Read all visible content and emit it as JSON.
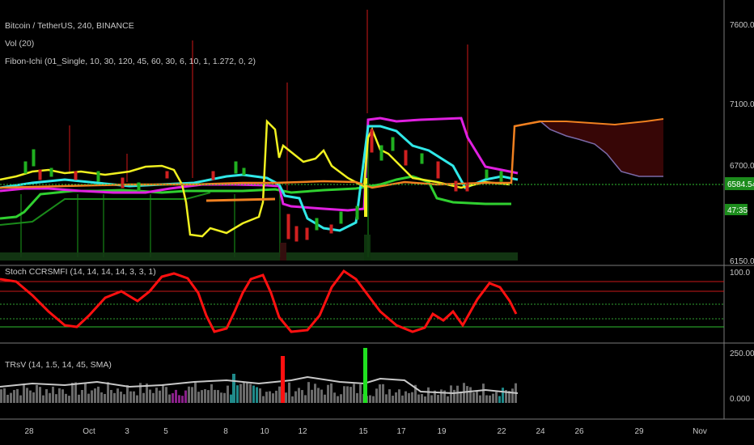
{
  "header": {
    "symbol": "Bitcoin / TetherUS, 240, BINANCE",
    "volume": "Vol (20)",
    "indicator": "Fibon-Ichi (01_Single, 10, 30, 120, 45, 60, 30, 6, 10, 1, 1.272, 0, 2)"
  },
  "oscillator": {
    "label": "Stoch CCRSMFI (14, 14, 14, 14, 3, 3, 1)"
  },
  "trsv": {
    "label": "TRsV (14, 1.5, 14, 45, SMA)"
  },
  "price_axis": {
    "ticks": [
      "7600.00",
      "7100.00",
      "6700.00",
      "6150.00"
    ],
    "last_price": "6584.54",
    "countdown": "47:35",
    "badge_color": "#1c8c1c"
  },
  "osc_axis": {
    "ticks": [
      "100.0"
    ]
  },
  "trsv_axis": {
    "ticks": [
      "250.000",
      "0.000"
    ]
  },
  "time_axis": {
    "labels": [
      "28",
      "Oct",
      "3",
      "5",
      "8",
      "10",
      "12",
      "15",
      "17",
      "19",
      "22",
      "24",
      "26",
      "29",
      "Nov"
    ]
  },
  "colors": {
    "background": "#000000",
    "magenta": "#e020e0",
    "cyan": "#30e8e8",
    "yellow": "#f0f020",
    "orange": "#f08020",
    "green": "#30d030",
    "red_osc": "#ff1010",
    "cloud": "#3a0606"
  },
  "chart_data": [
    {
      "type": "line",
      "title": "Bitcoin / TetherUS, 240, BINANCE",
      "x": [
        "28",
        "Oct",
        "3",
        "5",
        "8",
        "10",
        "12",
        "15",
        "17",
        "19",
        "22",
        "24",
        "26",
        "29",
        "Nov"
      ],
      "series_note": "",
      "ylabel": "",
      "yticks": [
        7600,
        7100,
        6700,
        6150
      ],
      "last_price": 6584.54,
      "series": [
        {
          "name": "",
          "values": [
            6560,
            6610,
            6620,
            6585,
            6570,
            6420,
            6500,
            6580,
            6990,
            6820,
            6700,
            6610,
            6585,
            6990,
            6985,
            6900,
            6700,
            6660
          ]
        }
      ]
    },
    {
      "type": "line",
      "title": "Stoch CCRSMFI (14, 14, 14, 14, 3, 3, 1)",
      "ylim": [
        0,
        100
      ],
      "yticks": [
        100
      ],
      "series": [
        {
          "name": "",
          "values": [
            90,
            60,
            25,
            20,
            55,
            85,
            95,
            60,
            20,
            88,
            50,
            20,
            15,
            95,
            55,
            10,
            5,
            40,
            30,
            55,
            85,
            30
          ]
        }
      ]
    },
    {
      "type": "bar",
      "title": "TRsV (14, 1.5, 14, 45, SMA)",
      "ylim": [
        0,
        250
      ],
      "yticks": [
        250,
        0
      ],
      "spikes": [
        {
          "x": "11",
          "value": 160,
          "color": "red"
        },
        {
          "x": "15",
          "value": 255,
          "color": "green"
        }
      ]
    }
  ]
}
